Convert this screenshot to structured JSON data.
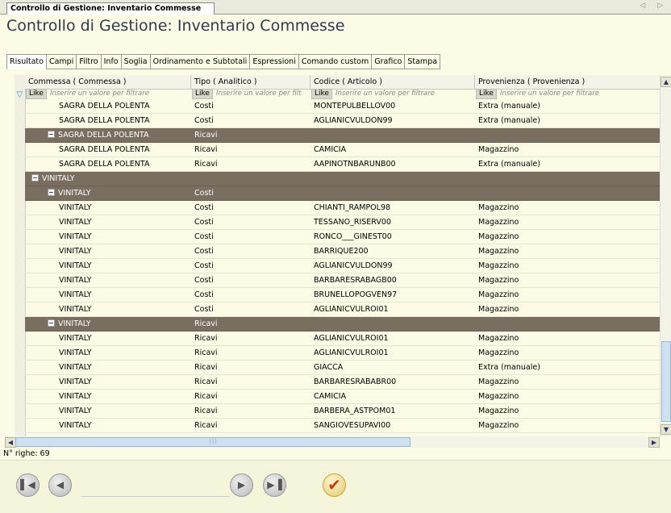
{
  "doc_tab": {
    "title": "Controllo di Gestione: Inventario Commesse",
    "nav_arrows": "◁ ▷"
  },
  "page_title": "Controllo di Gestione: Inventario Commesse",
  "sub_tabs": [
    "Risultato",
    "Campi",
    "Filtro",
    "Info",
    "Soglia",
    "Ordinamento e Subtotali",
    "Espressioni",
    "Comando custom",
    "Grafico",
    "Stampa"
  ],
  "columns": [
    {
      "header": "Commessa ( Commessa )",
      "filter_op": "Like",
      "placeholder": "Inserire un valore per filtrare"
    },
    {
      "header": "Tipo ( Analitico )",
      "filter_op": "Like",
      "placeholder": "Inserire un valore per filt"
    },
    {
      "header": "Codice ( Articolo )",
      "filter_op": "Like",
      "placeholder": "Inserire un valore per filtrare"
    },
    {
      "header": "Provenienza ( Provenienza )",
      "filter_op": "Like",
      "placeholder": "Inserire un valore per filtrare"
    }
  ],
  "rows": [
    {
      "kind": "data",
      "commessa": "SAGRA DELLA POLENTA",
      "tipo": "Costi",
      "codice": "MONTEPULBELLOV00",
      "provenienza": "Extra (manuale)"
    },
    {
      "kind": "data",
      "commessa": "SAGRA DELLA POLENTA",
      "tipo": "Costi",
      "codice": "AGLIANICVULDON99",
      "provenienza": "Extra (manuale)"
    },
    {
      "kind": "group2",
      "commessa": "SAGRA DELLA POLENTA",
      "tipo": "Ricavi",
      "codice": "",
      "provenienza": ""
    },
    {
      "kind": "data",
      "commessa": "SAGRA DELLA POLENTA",
      "tipo": "Ricavi",
      "codice": "CAMICIA",
      "provenienza": "Magazzino"
    },
    {
      "kind": "data",
      "commessa": "SAGRA DELLA POLENTA",
      "tipo": "Ricavi",
      "codice": "AAPINOTNBARUNB00",
      "provenienza": "Extra (manuale)"
    },
    {
      "kind": "group1",
      "commessa": "VINITALY",
      "tipo": "",
      "codice": "",
      "provenienza": ""
    },
    {
      "kind": "group2",
      "commessa": "VINITALY",
      "tipo": "Costi",
      "codice": "",
      "provenienza": ""
    },
    {
      "kind": "data",
      "commessa": "VINITALY",
      "tipo": "Costi",
      "codice": "CHIANTI_RAMPOL98",
      "provenienza": "Magazzino"
    },
    {
      "kind": "data",
      "commessa": "VINITALY",
      "tipo": "Costi",
      "codice": "TESSANO_RISERV00",
      "provenienza": "Magazzino"
    },
    {
      "kind": "data",
      "commessa": "VINITALY",
      "tipo": "Costi",
      "codice": "RONCO___GINEST00",
      "provenienza": "Magazzino"
    },
    {
      "kind": "data",
      "commessa": "VINITALY",
      "tipo": "Costi",
      "codice": "BARRIQUE200",
      "provenienza": "Magazzino"
    },
    {
      "kind": "data",
      "commessa": "VINITALY",
      "tipo": "Costi",
      "codice": "AGLIANICVULDON99",
      "provenienza": "Magazzino"
    },
    {
      "kind": "data",
      "commessa": "VINITALY",
      "tipo": "Costi",
      "codice": "BARBARESRABAGB00",
      "provenienza": "Magazzino"
    },
    {
      "kind": "data",
      "commessa": "VINITALY",
      "tipo": "Costi",
      "codice": "BRUNELLOPOGVEN97",
      "provenienza": "Magazzino"
    },
    {
      "kind": "data",
      "commessa": "VINITALY",
      "tipo": "Costi",
      "codice": "AGLIANICVULROI01",
      "provenienza": "Magazzino"
    },
    {
      "kind": "group2",
      "commessa": "VINITALY",
      "tipo": "Ricavi",
      "codice": "",
      "provenienza": ""
    },
    {
      "kind": "data",
      "commessa": "VINITALY",
      "tipo": "Ricavi",
      "codice": "AGLIANICVULROI01",
      "provenienza": "Magazzino"
    },
    {
      "kind": "data",
      "commessa": "VINITALY",
      "tipo": "Ricavi",
      "codice": "AGLIANICVULROI01",
      "provenienza": "Magazzino"
    },
    {
      "kind": "data",
      "commessa": "VINITALY",
      "tipo": "Ricavi",
      "codice": "GIACCA",
      "provenienza": "Extra (manuale)"
    },
    {
      "kind": "data",
      "commessa": "VINITALY",
      "tipo": "Ricavi",
      "codice": "BARBARESRABABR00",
      "provenienza": "Magazzino"
    },
    {
      "kind": "data",
      "commessa": "VINITALY",
      "tipo": "Ricavi",
      "codice": "CAMICIA",
      "provenienza": "Magazzino"
    },
    {
      "kind": "data",
      "commessa": "VINITALY",
      "tipo": "Ricavi",
      "codice": "BARBERA_ASTPOM01",
      "provenienza": "Magazzino"
    },
    {
      "kind": "data",
      "commessa": "VINITALY",
      "tipo": "Ricavi",
      "codice": "SANGIOVESUPAVI00",
      "provenienza": "Magazzino"
    }
  ],
  "row_count_label": "N° righe: 69",
  "colors": {
    "group_row_bg": "#7a6e60",
    "page_bg": "#fbfbe6",
    "title_color": "#303a4a",
    "confirm_check": "#c04010"
  }
}
